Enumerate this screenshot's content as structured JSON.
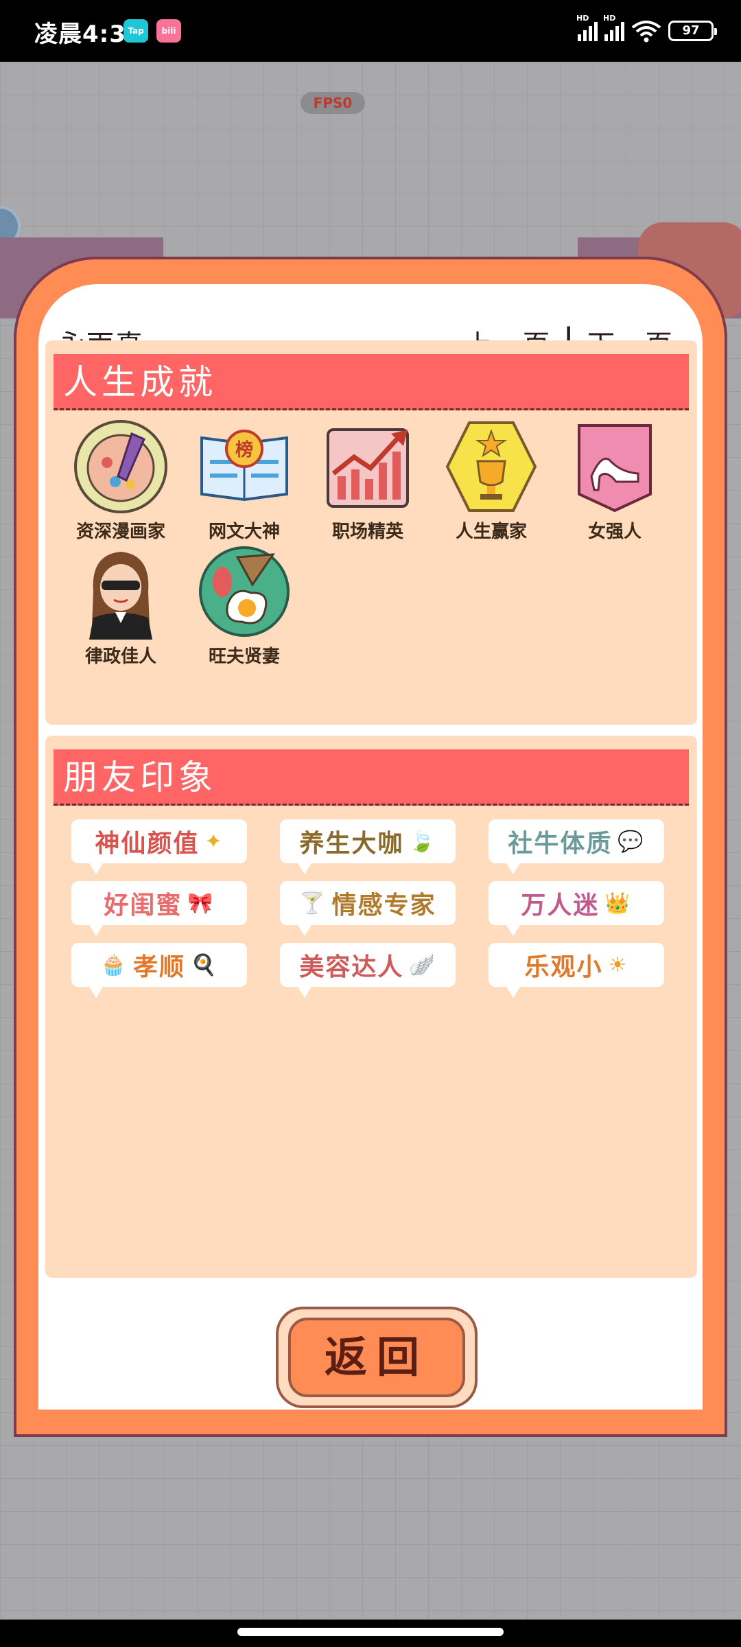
{
  "status": {
    "time": "凌晨4:32",
    "tap": "Tap",
    "bili": "bili",
    "hd1": "HD",
    "hd2": "HD",
    "battery": "97"
  },
  "game": {
    "fps": "FPS0"
  },
  "dialog": {
    "name": "永雨真",
    "prev": "上一页",
    "separator": "|",
    "next": "下一页",
    "achievements_title": "人生成就",
    "achievements": [
      {
        "label": "资深漫画家",
        "icon": "palette-icon"
      },
      {
        "label": "网文大神",
        "icon": "book-ranking-icon"
      },
      {
        "label": "职场精英",
        "icon": "growth-chart-icon"
      },
      {
        "label": "人生赢家",
        "icon": "trophy-icon"
      },
      {
        "label": "女强人",
        "icon": "high-heel-icon"
      },
      {
        "label": "律政佳人",
        "icon": "lawyer-woman-icon"
      },
      {
        "label": "旺夫贤妻",
        "icon": "fried-egg-plate-icon"
      }
    ],
    "impressions_title": "朋友印象",
    "impressions": [
      {
        "text": "神仙颜值",
        "color": "#d9534f",
        "emoji": "✦"
      },
      {
        "text": "养生大咖",
        "color": "#8a6a2a",
        "emoji": "🍃"
      },
      {
        "text": "社牛体质",
        "color": "#6a9a9a",
        "emoji": "💬"
      },
      {
        "text": "好闺蜜",
        "color": "#e86a6a",
        "emoji": "🎀"
      },
      {
        "text": "情感专家",
        "color": "#b07a2a",
        "emoji": "🍸"
      },
      {
        "text": "万人迷",
        "color": "#c05a8a",
        "emoji": "👑"
      },
      {
        "text": "孝顺",
        "color": "#e07a2a",
        "emoji": "🍳"
      },
      {
        "text": "美容达人",
        "color": "#d05a5a",
        "emoji": "🪽"
      },
      {
        "text": "乐观小",
        "color": "#e07a2a",
        "emoji": "☀"
      }
    ],
    "back_label": "返回"
  }
}
